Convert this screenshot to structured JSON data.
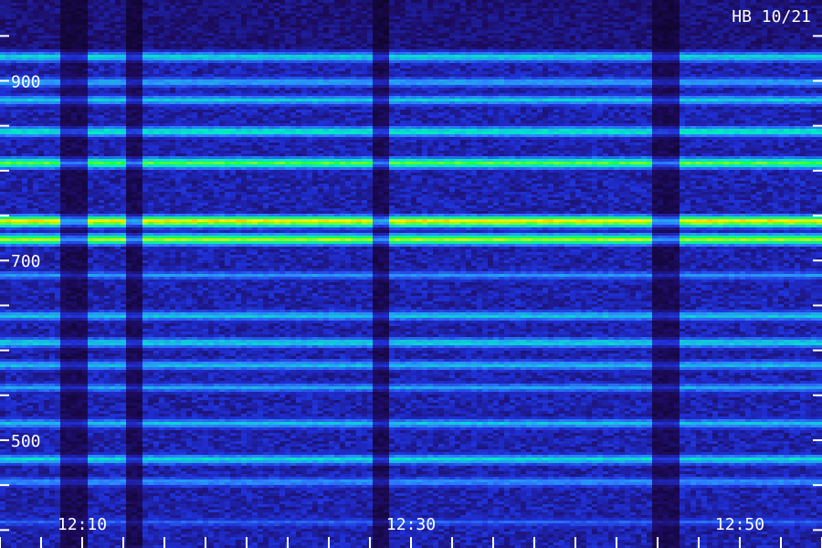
{
  "header": {
    "tag": "HB 10/21"
  },
  "chart_data": {
    "type": "heatmap",
    "title": "",
    "xlabel": "",
    "ylabel": "",
    "x_tick_labels": [
      "12:10",
      "12:30",
      "12:50"
    ],
    "y_tick_labels": [
      "900",
      "700",
      "500"
    ],
    "x_range": [
      "12:05",
      "12:55"
    ],
    "y_range": [
      380,
      990
    ],
    "colormap": [
      "#000000",
      "#1c0a5a",
      "#1f2fd4",
      "#2d86ff",
      "#00e9c8",
      "#18ff40",
      "#fff300",
      "#ff2a00"
    ],
    "bands": [
      {
        "freq": 928,
        "level": 0.55
      },
      {
        "freq": 900,
        "level": 0.48
      },
      {
        "freq": 880,
        "level": 0.52
      },
      {
        "freq": 845,
        "level": 0.6
      },
      {
        "freq": 810,
        "level": 0.72
      },
      {
        "freq": 745,
        "level": 0.9
      },
      {
        "freq": 725,
        "level": 0.8
      },
      {
        "freq": 685,
        "level": 0.42
      },
      {
        "freq": 640,
        "level": 0.52
      },
      {
        "freq": 610,
        "level": 0.55
      },
      {
        "freq": 585,
        "level": 0.5
      },
      {
        "freq": 560,
        "level": 0.45
      },
      {
        "freq": 520,
        "level": 0.5
      },
      {
        "freq": 480,
        "level": 0.55
      },
      {
        "freq": 455,
        "level": 0.45
      },
      {
        "freq": 410,
        "level": 0.35
      }
    ],
    "dropouts": [
      {
        "start": "12:09",
        "end": "12:10"
      },
      {
        "start": "12:13",
        "end": "12:13:30"
      },
      {
        "start": "12:28",
        "end": "12:28:30"
      },
      {
        "start": "12:45",
        "end": "12:46"
      }
    ]
  }
}
